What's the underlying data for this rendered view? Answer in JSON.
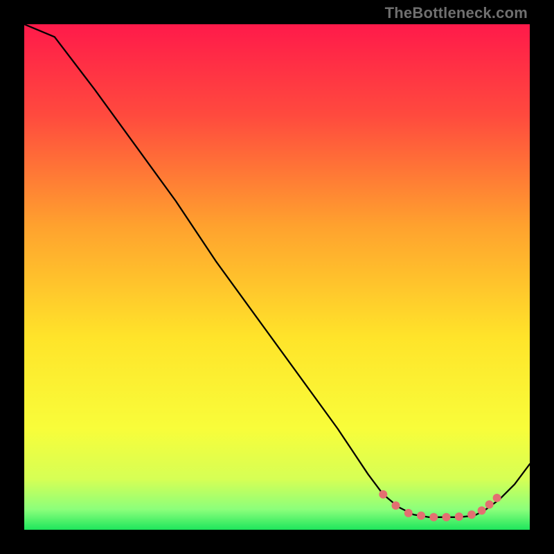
{
  "attribution": "TheBottleneck.com",
  "colors": {
    "background": "#000000",
    "line": "#000000",
    "dots": "#e36f71",
    "gradient_stops": [
      {
        "offset": 0.0,
        "color": "#ff1a4a"
      },
      {
        "offset": 0.18,
        "color": "#ff4a3e"
      },
      {
        "offset": 0.4,
        "color": "#ffa22e"
      },
      {
        "offset": 0.62,
        "color": "#ffe42a"
      },
      {
        "offset": 0.8,
        "color": "#f8fd3a"
      },
      {
        "offset": 0.9,
        "color": "#d6ff55"
      },
      {
        "offset": 0.96,
        "color": "#8bff7b"
      },
      {
        "offset": 1.0,
        "color": "#1ee65c"
      }
    ]
  },
  "chart_data": {
    "type": "line",
    "title": "",
    "xlabel": "",
    "ylabel": "",
    "xlim": [
      0,
      100
    ],
    "ylim": [
      0,
      100
    ],
    "series": [
      {
        "name": "curve",
        "x": [
          0,
          6,
          14,
          22,
          30,
          38,
          46,
          54,
          62,
          68,
          71,
          74,
          77,
          80,
          83,
          86,
          89,
          91,
          94,
          97,
          100
        ],
        "y": [
          100,
          97.5,
          87,
          76,
          65,
          53,
          42,
          31,
          20,
          11,
          7,
          4.5,
          3,
          2.5,
          2.5,
          2.5,
          2.8,
          3.8,
          6,
          9,
          13
        ]
      }
    ],
    "highlight_dots": {
      "name": "dots",
      "x": [
        71,
        73.5,
        76,
        78.5,
        81,
        83.5,
        86,
        88.5,
        90.5,
        92,
        93.5
      ],
      "y": [
        7,
        4.8,
        3.3,
        2.8,
        2.5,
        2.5,
        2.6,
        3.0,
        3.8,
        5.0,
        6.3
      ]
    }
  }
}
